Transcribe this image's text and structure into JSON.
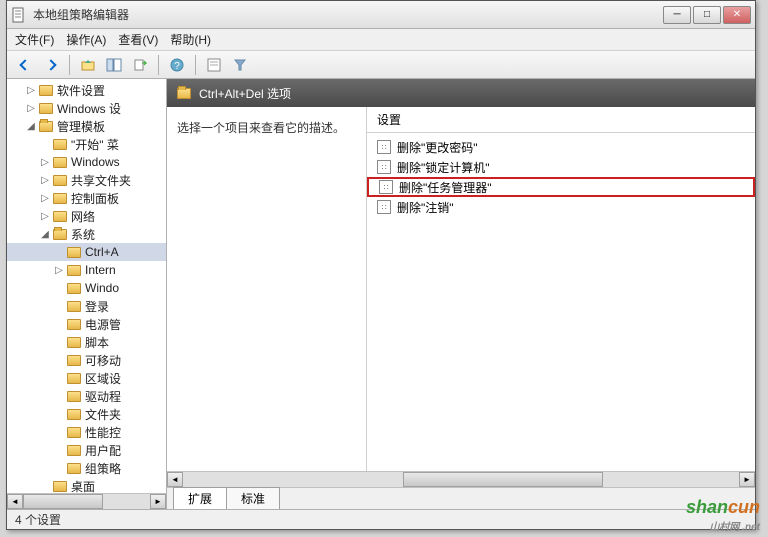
{
  "window": {
    "title": "本地组策略编辑器"
  },
  "menu": {
    "file": "文件(F)",
    "action": "操作(A)",
    "view": "查看(V)",
    "help": "帮助(H)"
  },
  "tree": [
    {
      "indent": 1,
      "tw": "▷",
      "label": "软件设置"
    },
    {
      "indent": 1,
      "tw": "▷",
      "label": "Windows 设"
    },
    {
      "indent": 1,
      "tw": "◢",
      "label": "管理模板",
      "open": true
    },
    {
      "indent": 2,
      "tw": "",
      "label": "\"开始\" 菜"
    },
    {
      "indent": 2,
      "tw": "▷",
      "label": "Windows"
    },
    {
      "indent": 2,
      "tw": "▷",
      "label": "共享文件夹"
    },
    {
      "indent": 2,
      "tw": "▷",
      "label": "控制面板"
    },
    {
      "indent": 2,
      "tw": "▷",
      "label": "网络"
    },
    {
      "indent": 2,
      "tw": "◢",
      "label": "系统",
      "open": true
    },
    {
      "indent": 3,
      "tw": "",
      "label": "Ctrl+A",
      "selected": true
    },
    {
      "indent": 3,
      "tw": "▷",
      "label": "Intern"
    },
    {
      "indent": 3,
      "tw": "",
      "label": "Windo"
    },
    {
      "indent": 3,
      "tw": "",
      "label": "登录"
    },
    {
      "indent": 3,
      "tw": "",
      "label": "电源管"
    },
    {
      "indent": 3,
      "tw": "",
      "label": "脚本"
    },
    {
      "indent": 3,
      "tw": "",
      "label": "可移动"
    },
    {
      "indent": 3,
      "tw": "",
      "label": "区域设"
    },
    {
      "indent": 3,
      "tw": "",
      "label": "驱动程"
    },
    {
      "indent": 3,
      "tw": "",
      "label": "文件夹"
    },
    {
      "indent": 3,
      "tw": "",
      "label": "性能控"
    },
    {
      "indent": 3,
      "tw": "",
      "label": "用户配"
    },
    {
      "indent": 3,
      "tw": "",
      "label": "组策略"
    },
    {
      "indent": 2,
      "tw": "",
      "label": "桌面"
    }
  ],
  "main": {
    "header": "Ctrl+Alt+Del 选项",
    "desc_prompt": "选择一个项目来查看它的描述。",
    "settings_header": "设置",
    "items": [
      {
        "label": "删除\"更改密码\"",
        "highlight": false
      },
      {
        "label": "删除\"锁定计算机\"",
        "highlight": false
      },
      {
        "label": "删除\"任务管理器\"",
        "highlight": true
      },
      {
        "label": "删除\"注销\"",
        "highlight": false
      }
    ]
  },
  "tabs": {
    "extended": "扩展",
    "standard": "标准"
  },
  "status": "4 个设置",
  "watermark": {
    "text1": "shan",
    "text2": "cun",
    "sub": "山村网 .net"
  }
}
